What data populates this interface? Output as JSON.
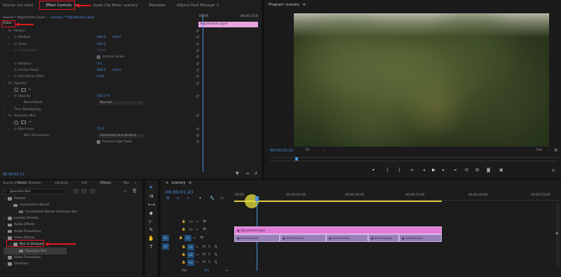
{
  "effect_controls_panel": {
    "tabs": [
      "Source: (no clips)",
      "Effect Controls",
      "Audio Clip Mixer: scenery",
      "Metadata",
      "AEJuice Pack Manager 3"
    ],
    "active_tab": "Effect Controls",
    "menu_glyph": "≡",
    "source_label": "Source * Adjustment Layer",
    "sequence_label": "scenery * Adjustment Layer",
    "ruler_start": "00:00",
    "ruler_end": "00:00:15:0",
    "clip_name": "Adjustment Layer",
    "section_label": "Video",
    "timecode": "00:00:01:11",
    "properties": [
      {
        "label": "Motion"
      },
      {
        "label": "Position",
        "value": "960.0",
        "value2": "540.0"
      },
      {
        "label": "Scale",
        "value": "100.0"
      },
      {
        "label": "Scale Width",
        "value": "100.0"
      },
      {
        "label": "Uniform Scale"
      },
      {
        "label": "Rotation",
        "value": "0.0"
      },
      {
        "label": "Anchor Point",
        "value": "960.0",
        "value2": "540.0"
      },
      {
        "label": "Anti-flicker Filter",
        "value": "0.00"
      },
      {
        "label": "Opacity"
      },
      {
        "label": "Opacity",
        "value": "100.0 %"
      },
      {
        "label": "Blend Mode",
        "value": "Normal"
      },
      {
        "label": "Time Remapping"
      },
      {
        "label": "Gaussian Blur"
      },
      {
        "label": "Blurriness",
        "value": "75.0"
      },
      {
        "label": "Blur Dimensions",
        "value": "Horizontal and Vertical"
      },
      {
        "label": "Repeat Edge Pixels"
      }
    ]
  },
  "program_monitor": {
    "title": "Program: scenery",
    "menu_glyph": "≡",
    "timecode": "00:00:01:11",
    "fit_label": "Fit",
    "full_label": "Full"
  },
  "project_panel": {
    "tabs": [
      "Source Effects",
      "Media Browser",
      "Libraries",
      "Info",
      "Effects",
      "Mar"
    ],
    "active_tab": "Effects",
    "search_value": "gaussian blur",
    "tree": [
      {
        "label": "Presets",
        "depth": 0
      },
      {
        "label": "Convolution Kernel",
        "depth": 1
      },
      {
        "label": "Convolution Kernel Gaussian Blur",
        "depth": 2
      },
      {
        "label": "Lumetri Presets",
        "depth": 0
      },
      {
        "label": "Audio Effects",
        "depth": 0
      },
      {
        "label": "Audio Transitions",
        "depth": 0
      },
      {
        "label": "Video Effects",
        "depth": 0
      },
      {
        "label": "Blur & Sharpen",
        "depth": 1
      },
      {
        "label": "Gaussian Blur",
        "depth": 2
      },
      {
        "label": "Video Transitions",
        "depth": 0
      },
      {
        "label": "Favorites",
        "depth": 0
      }
    ]
  },
  "timeline": {
    "title": "scenery",
    "menu_glyph": "≡",
    "timecode": "00:00:01:23",
    "ruler": [
      "00:00",
      "00:00:05:00",
      "00:00:10:00",
      "00:00:15:00",
      "00:00:20:00",
      "00:00:25:00"
    ],
    "video_tracks": [
      "V3",
      "V2",
      "V1"
    ],
    "audio_tracks": [
      "A1",
      "A2",
      "A3"
    ],
    "source_video": "V1",
    "source_audio": "A1",
    "mix_label": "Mix",
    "mix_value": "0.0",
    "mute_label": "M",
    "solo_label": "S",
    "adjustment_clip": "Adjustment Layer",
    "clip_name": "scenery.mov"
  },
  "colors": {
    "highlight_red": "#e0181e",
    "clip_purple": "#9680b8",
    "adjustment_pink": "#e07bd8",
    "playhead_blue": "#4a90e2",
    "work_area_yellow": "#d9c33a"
  },
  "icons": {
    "tools": [
      "selection-tool-icon",
      "track-select-icon",
      "ripple-edit-icon",
      "razor-icon",
      "slip-icon",
      "pen-icon",
      "hand-icon",
      "type-icon"
    ]
  }
}
